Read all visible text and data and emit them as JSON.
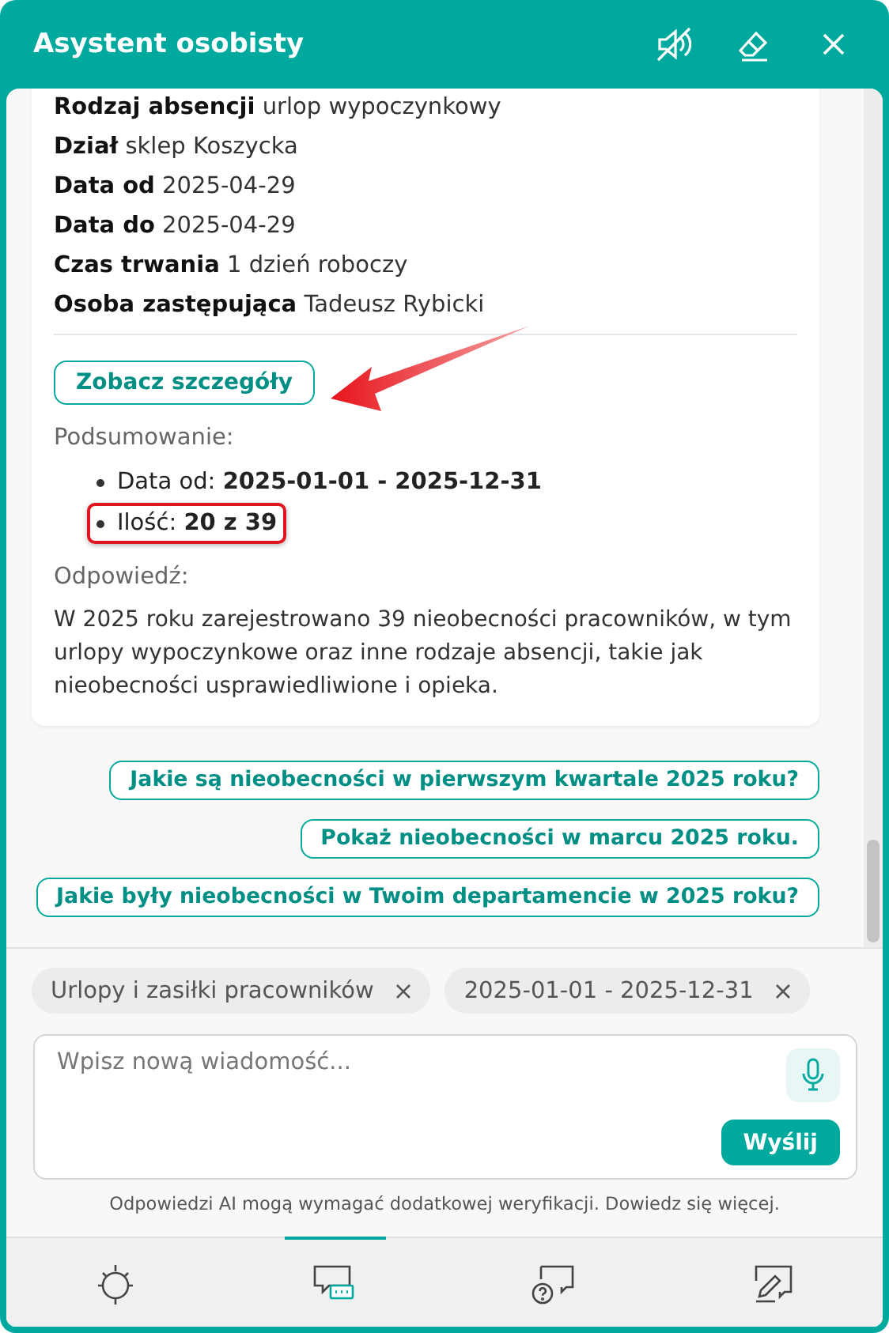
{
  "window": {
    "title": "Asystent osobisty"
  },
  "details": [
    "**Rodzaj absencji** urlop wypoczynkowy",
    "**Dział** sklep Koszycka",
    "**Data od** 2025-04-29",
    "**Data do** 2025-04-29",
    "**Czas trwania** 1 dzień roboczy",
    "**Osoba zastępująca** Tadeusz Rybicki"
  ],
  "details_button": "Zobacz szczegóły",
  "summary_label": "Podsumowanie:",
  "summary_items": [
    {
      "text": "Data od: **2025-01-01 - 2025-12-31**",
      "highlighted": false
    },
    {
      "text": "Ilość: **20 z 39**",
      "highlighted": true
    }
  ],
  "answer_label": "Odpowiedź:",
  "answer": "W 2025 roku zarejestrowano 39 nieobecności pracowników, w tym urlopy wypoczynkowe oraz inne rodzaje absencji, takie jak nieobecności usprawiedliwione i opieka.",
  "suggestions": [
    "Jakie są nieobecności w pierwszym kwartale 2025 roku?",
    "Pokaż nieobecności w marcu 2025 roku.",
    "Jakie były nieobecności w Twoim departamencie w 2025 roku?"
  ],
  "filters": [
    "Urlopy i zasiłki pracowników",
    "2025-01-01 - 2025-12-31"
  ],
  "message_input": {
    "placeholder": "Wpisz nową wiadomość..."
  },
  "send_button": "Wyślij",
  "disclaimer": "Odpowiedzi AI mogą wymagać dodatkowej weryfikacji. Dowiedz się więcej.",
  "tabs": [
    {
      "kind": "ideas",
      "selected": false
    },
    {
      "kind": "chat",
      "selected": true
    },
    {
      "kind": "help",
      "selected": false
    },
    {
      "kind": "edit",
      "selected": false
    }
  ]
}
